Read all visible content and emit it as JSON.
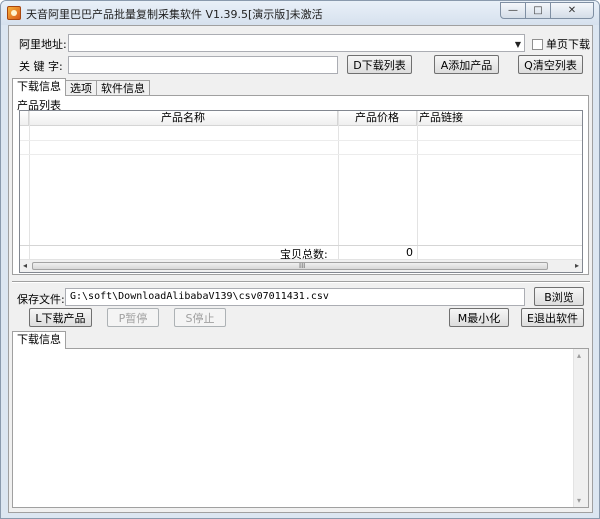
{
  "window": {
    "title": "天音阿里巴巴产品批量复制采集软件 V1.39.5[演示版]未激活",
    "min_glyph": "—",
    "max_glyph": "□",
    "close_glyph": "✕"
  },
  "top": {
    "url_label": "阿里地址:",
    "url_value": "",
    "single_page_label": "单页下载",
    "keyword_label": "关 键 字:",
    "keyword_value": "",
    "download_list_btn": "D下载列表",
    "add_product_btn": "A添加产品",
    "clear_list_btn": "Q清空列表"
  },
  "tabs": [
    {
      "label": "下载信息",
      "active": true
    },
    {
      "label": "选项",
      "active": false
    },
    {
      "label": "软件信息",
      "active": false
    }
  ],
  "product_list": {
    "group_label": "产品列表",
    "columns": [
      "产品名称",
      "产品价格",
      "产品链接"
    ],
    "rows": [],
    "total_label": "宝贝总数:",
    "total_value": "0",
    "scroll_left": "◂",
    "scroll_right": "▸",
    "scroll_grip": "III"
  },
  "save": {
    "label": "保存文件:",
    "path": "G:\\soft\\DownloadAlibabaV139\\csv07011431.csv",
    "browse_btn": "B浏览"
  },
  "actions": {
    "download_btn": "L下载产品",
    "pause_btn": "P暂停",
    "stop_btn": "S停止",
    "minimize_btn": "M最小化",
    "exit_btn": "E退出软件"
  },
  "log": {
    "tab_label": "下载信息",
    "content": "",
    "scroll_up": "▴",
    "scroll_down": "▾"
  }
}
